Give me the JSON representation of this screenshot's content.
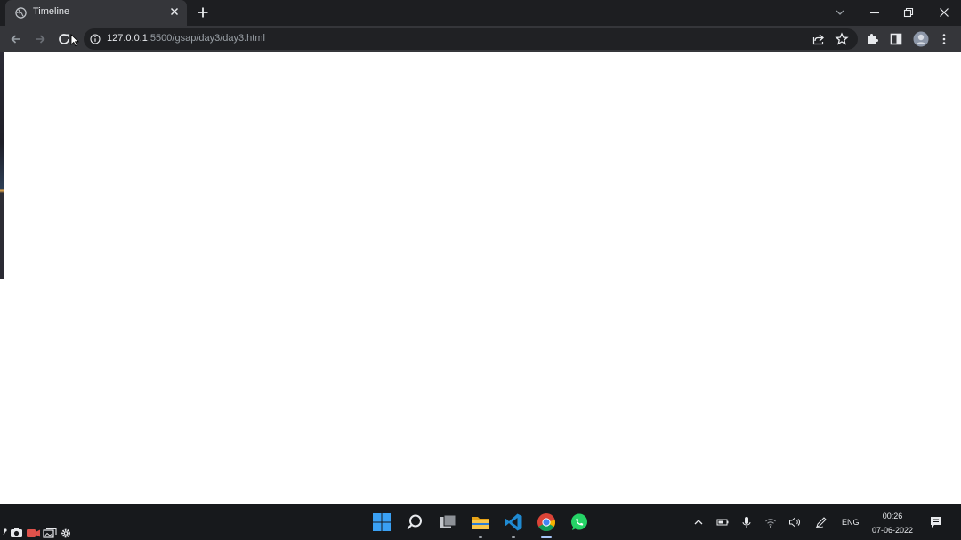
{
  "browser": {
    "tab": {
      "title": "Timeline",
      "favicon": "globe-icon"
    },
    "address_bar": {
      "host": "127.0.0.1",
      "path": ":5500/gsap/day3/day3.html"
    }
  },
  "taskbar": {
    "apps": [
      "windows-start-icon",
      "search-icon",
      "task-view-icon",
      "file-explorer-icon",
      "vscode-icon",
      "chrome-icon",
      "whatsapp-icon"
    ],
    "active_app": "chrome-icon",
    "language": "ENG",
    "time": "00:26",
    "date": "07-06-2022"
  },
  "colors": {
    "titlebar": "#1d1e21",
    "toolbar": "#35363a",
    "omnibox": "#202124",
    "page": "#ffffff",
    "taskbar": "#17191c"
  }
}
